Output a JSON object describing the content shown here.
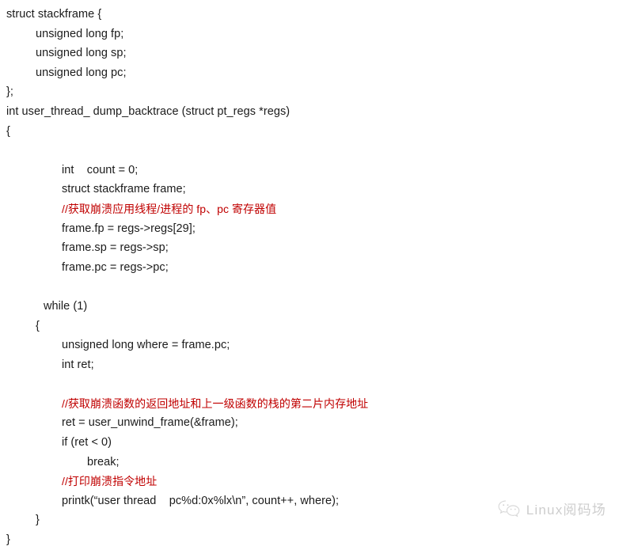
{
  "document": {
    "title": "user_thread_dump_backtrace code listing",
    "language": "c",
    "background_color": "#ffffff",
    "text_color": "#1b1b1b",
    "comment_color": "#c00000",
    "lines": [
      {
        "indent": 0,
        "kind": "code",
        "text": "struct stackframe {"
      },
      {
        "indent": 1,
        "kind": "code",
        "text": "unsigned long fp;"
      },
      {
        "indent": 1,
        "kind": "code",
        "text": "unsigned long sp;"
      },
      {
        "indent": 1,
        "kind": "code",
        "text": "unsigned long pc;"
      },
      {
        "indent": 0,
        "kind": "code",
        "text": "};"
      },
      {
        "indent": 0,
        "kind": "code",
        "text": "int user_thread_ dump_backtrace (struct pt_regs *regs)"
      },
      {
        "indent": 0,
        "kind": "code",
        "text": "{"
      },
      {
        "indent": 0,
        "kind": "blank",
        "text": " "
      },
      {
        "indent": 3,
        "kind": "code",
        "text": "int    count = 0;"
      },
      {
        "indent": 3,
        "kind": "code",
        "text": "struct stackframe frame;"
      },
      {
        "indent": 3,
        "kind": "comment",
        "text": "//获取崩溃应用线程/进程的 fp、pc 寄存器值"
      },
      {
        "indent": 3,
        "kind": "code",
        "text": "frame.fp = regs->regs[29];"
      },
      {
        "indent": 3,
        "kind": "code",
        "text": "frame.sp = regs->sp;"
      },
      {
        "indent": 3,
        "kind": "code",
        "text": "frame.pc = regs->pc;"
      },
      {
        "indent": 0,
        "kind": "blank",
        "text": " "
      },
      {
        "indent": 2,
        "kind": "code",
        "text": "while (1)"
      },
      {
        "indent": 1,
        "kind": "code",
        "text": "{"
      },
      {
        "indent": 3,
        "kind": "code",
        "text": "unsigned long where = frame.pc;"
      },
      {
        "indent": 3,
        "kind": "code",
        "text": "int ret;"
      },
      {
        "indent": 0,
        "kind": "blank",
        "text": " "
      },
      {
        "indent": 3,
        "kind": "comment",
        "text": "//获取崩溃函数的返回地址和上一级函数的栈的第二片内存地址"
      },
      {
        "indent": 3,
        "kind": "code",
        "text": "ret = user_unwind_frame(&frame);"
      },
      {
        "indent": 3,
        "kind": "code",
        "text": "if (ret < 0)"
      },
      {
        "indent": 4,
        "kind": "code",
        "text": "break;"
      },
      {
        "indent": 3,
        "kind": "comment",
        "text": "//打印崩溃指令地址"
      },
      {
        "indent": 3,
        "kind": "code",
        "text": "printk(“user thread    pc%d:0x%lx\\n”, count++, where);"
      },
      {
        "indent": 1,
        "kind": "code",
        "text": "}"
      },
      {
        "indent": 0,
        "kind": "code",
        "text": "}"
      }
    ]
  },
  "watermark": {
    "icon": "wechat-icon",
    "text": "Linux阅码场",
    "color": "#8a8a8a"
  }
}
